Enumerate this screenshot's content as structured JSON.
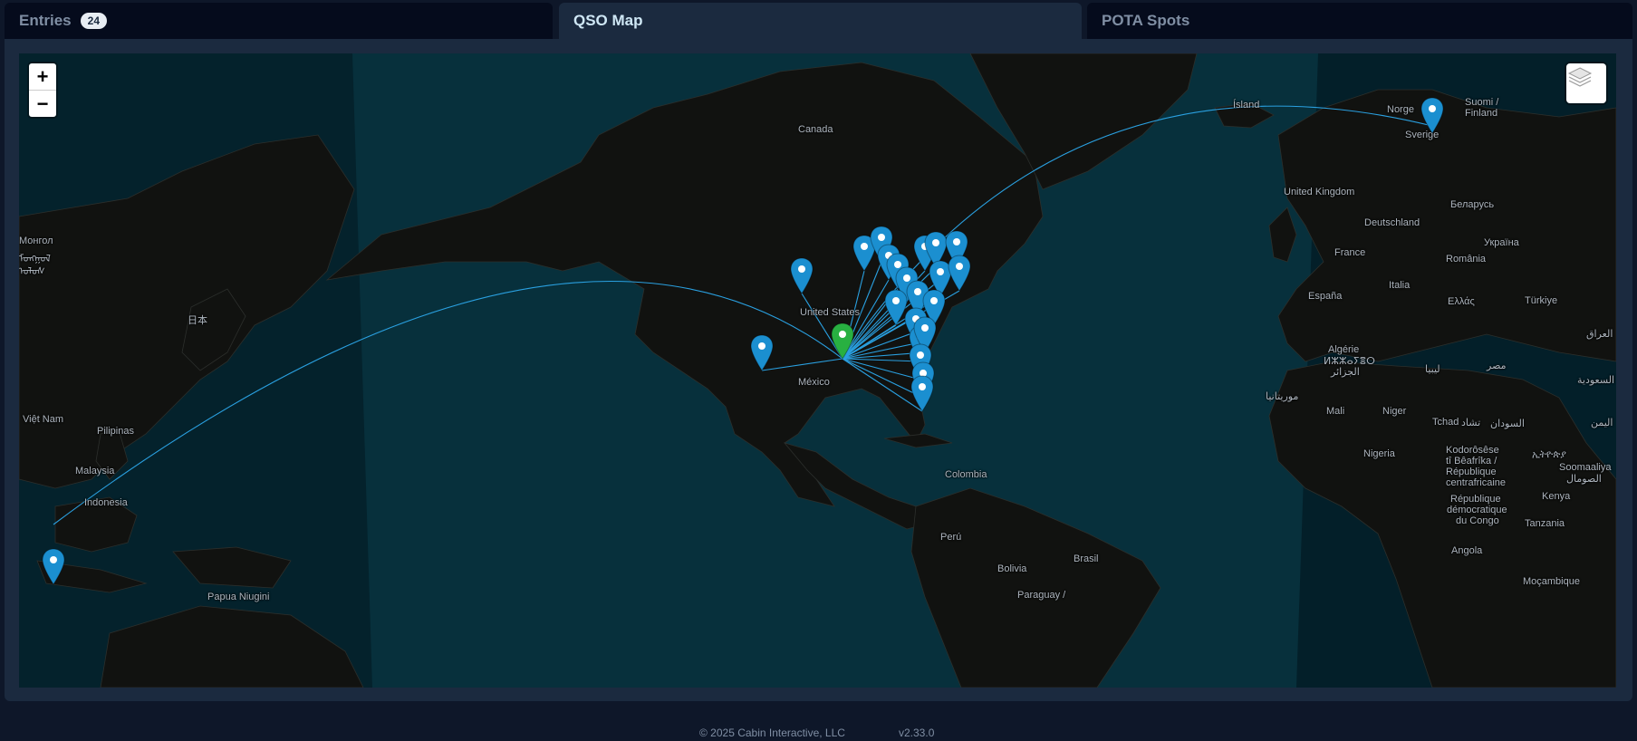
{
  "tabs": {
    "entries": {
      "label": "Entries",
      "count": "24"
    },
    "qso_map": {
      "label": "QSO Map"
    },
    "pota_spots": {
      "label": "POTA Spots"
    }
  },
  "map": {
    "zoom_in": "+",
    "zoom_out": "−",
    "layers_icon": "layers-icon",
    "home_color": "#28b041",
    "contact_color": "#1b8fd0",
    "line_color": "#2aa0e0",
    "labels": [
      {
        "text": "Canada"
      },
      {
        "text": "Ísland"
      },
      {
        "text": "Norge"
      },
      {
        "text": "Suomi /"
      },
      {
        "text": "Finland"
      },
      {
        "text": "Sverige"
      },
      {
        "text": "United Kingdom"
      },
      {
        "text": "Беларусь"
      },
      {
        "text": "Deutschland"
      },
      {
        "text": "Україна"
      },
      {
        "text": "France"
      },
      {
        "text": "România"
      },
      {
        "text": "España"
      },
      {
        "text": "Italia"
      },
      {
        "text": "Ελλάς"
      },
      {
        "text": "Türkiye"
      },
      {
        "text": "Algérie"
      },
      {
        "text": "ⵍⵣⵣⴰⵢⴻⵔ"
      },
      {
        "text": "الجزائر"
      },
      {
        "text": "ليبيا"
      },
      {
        "text": "مصر"
      },
      {
        "text": "العراق"
      },
      {
        "text": "السعودية"
      },
      {
        "text": "موريتانيا"
      },
      {
        "text": "Mali"
      },
      {
        "text": "Niger"
      },
      {
        "text": "Tchad"
      },
      {
        "text": "تشاد"
      },
      {
        "text": "السودان"
      },
      {
        "text": "اليمن"
      },
      {
        "text": "Nigeria"
      },
      {
        "text": "Kodorôsêse"
      },
      {
        "text": "tî Bêafrîka /"
      },
      {
        "text": "République"
      },
      {
        "text": "centrafricaine"
      },
      {
        "text": "ኢትዮጵያ"
      },
      {
        "text": "Soomaaliya"
      },
      {
        "text": "الصومال"
      },
      {
        "text": "République"
      },
      {
        "text": "démocratique"
      },
      {
        "text": "du Congo"
      },
      {
        "text": "Kenya"
      },
      {
        "text": "Tanzania"
      },
      {
        "text": "Angola"
      },
      {
        "text": "Moçambique"
      },
      {
        "text": "United States"
      },
      {
        "text": "México"
      },
      {
        "text": "Colombia"
      },
      {
        "text": "Perú"
      },
      {
        "text": "Brasil"
      },
      {
        "text": "Bolivia"
      },
      {
        "text": "Paraguay /"
      },
      {
        "text": "日本"
      },
      {
        "text": "Монгол"
      },
      {
        "text": "ᠮᠣᠩᠭᠣᠯ"
      },
      {
        "text": "ᠤᠯᠤᠰ"
      },
      {
        "text": "Việt Nam"
      },
      {
        "text": "Pilipinas"
      },
      {
        "text": "Malaysia"
      },
      {
        "text": "Indonesia"
      },
      {
        "text": "Papua Niugini"
      }
    ]
  },
  "footer": {
    "copyright": "© 2025 Cabin Interactive, LLC",
    "version": "v2.33.0"
  }
}
